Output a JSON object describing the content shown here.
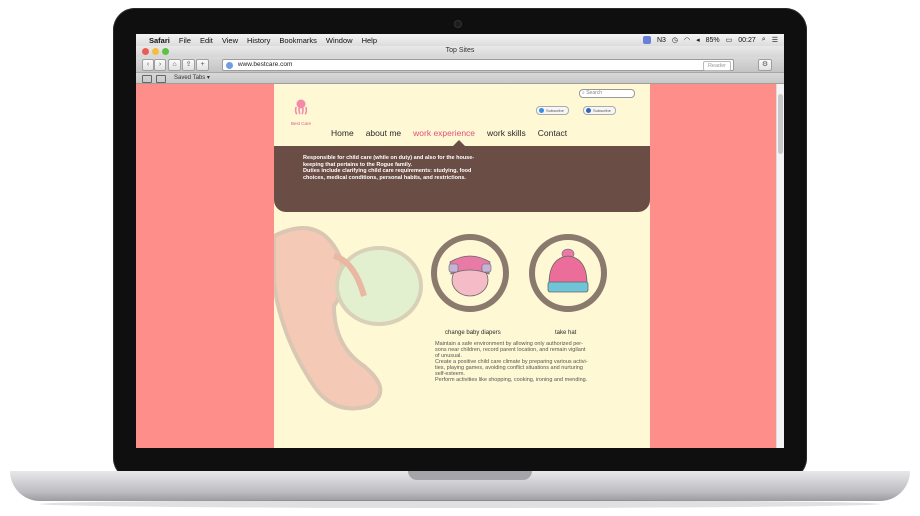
{
  "menubar": {
    "items": [
      "Safari",
      "File",
      "Edit",
      "View",
      "History",
      "Bookmarks",
      "Window",
      "Help"
    ],
    "status": {
      "n3": "N3",
      "battery": "85%",
      "clock": "00:27"
    }
  },
  "window": {
    "title": "Top Sites"
  },
  "toolbar": {
    "url": "www.bestcare.com",
    "reader_label": "Reader"
  },
  "bookmarks_bar": {
    "saved_tabs": "Saved Tabs ▾"
  },
  "site": {
    "logo_text": "Best Care",
    "search_placeholder": "Search",
    "social": [
      "Subscribe",
      "Subscribe"
    ],
    "nav": [
      "Home",
      "about me",
      "work experience",
      "work skills",
      "Contact"
    ],
    "active_nav": "work experience",
    "box_line1": "Responsible for child care (while on duty) and also for the house-",
    "box_line2": "keeping that pertains to the Rogue family.",
    "box_line3": "Duties include clarifying child care requirements: studying, food",
    "box_line4": "choices, medical conditions, personal habits, and restrictions.",
    "caption_left": "change baby diapers",
    "caption_right": "take hat",
    "body_lines": [
      "Maintain a safe environment by allowing only authorized per-",
      "sons near children, record parent location, and remain vigilant",
      "of unusual.",
      "Create a positive child care climate by preparing various activi-",
      "ties, playing games, avoiding conflict situations and nurturing",
      "self-esteem.",
      "Perform activities like shopping, cooking, ironing and mending."
    ]
  },
  "colors": {
    "sidebar_pink": "#fd8e8a",
    "page_cream": "#fff8d5",
    "brown_box": "#6a4d45",
    "active_nav": "#e0507a"
  }
}
